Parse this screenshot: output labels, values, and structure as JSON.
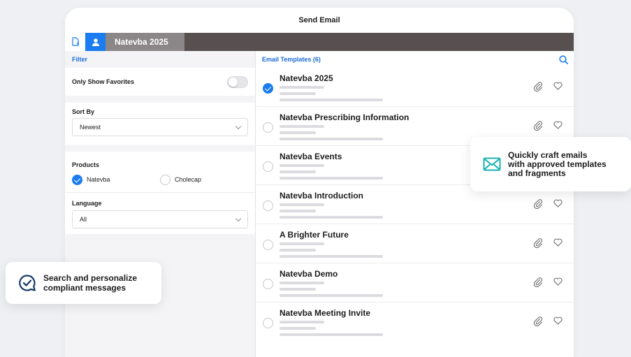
{
  "window": {
    "title": "Send Email"
  },
  "tabs": {
    "active_label": "Natevba 2025"
  },
  "filter": {
    "header": "Filter",
    "only_favorites_label": "Only Show Favorites",
    "sort_by": {
      "label": "Sort By",
      "value": "Newest"
    },
    "products": {
      "label": "Products",
      "items": [
        {
          "label": "Natevba",
          "checked": true
        },
        {
          "label": "Cholecap",
          "checked": false
        }
      ]
    },
    "language": {
      "label": "Language",
      "value": "All"
    }
  },
  "templates": {
    "header": "Email Templates (6)",
    "items": [
      {
        "name": "Natevba 2025",
        "selected": true
      },
      {
        "name": "Natevba Prescribing Information",
        "selected": false
      },
      {
        "name": "Natevba Events",
        "selected": false
      },
      {
        "name": "Natevba Introduction",
        "selected": false
      },
      {
        "name": "A Brighter Future",
        "selected": false
      },
      {
        "name": "Natevba Demo",
        "selected": false
      },
      {
        "name": "Natevba Meeting Invite",
        "selected": false
      }
    ]
  },
  "callouts": {
    "craft": {
      "line1": "Quickly craft emails",
      "line2": "with approved templates",
      "line3": "and fragments",
      "icon": "envelope-icon"
    },
    "search": {
      "line1": "Search and personalize",
      "line2": "compliant messages",
      "icon": "check-chat-icon"
    }
  },
  "colors": {
    "accent": "#1a7cf0",
    "tabbar": "#574f50",
    "teal": "#19b3b0",
    "navy": "#173a6a"
  }
}
